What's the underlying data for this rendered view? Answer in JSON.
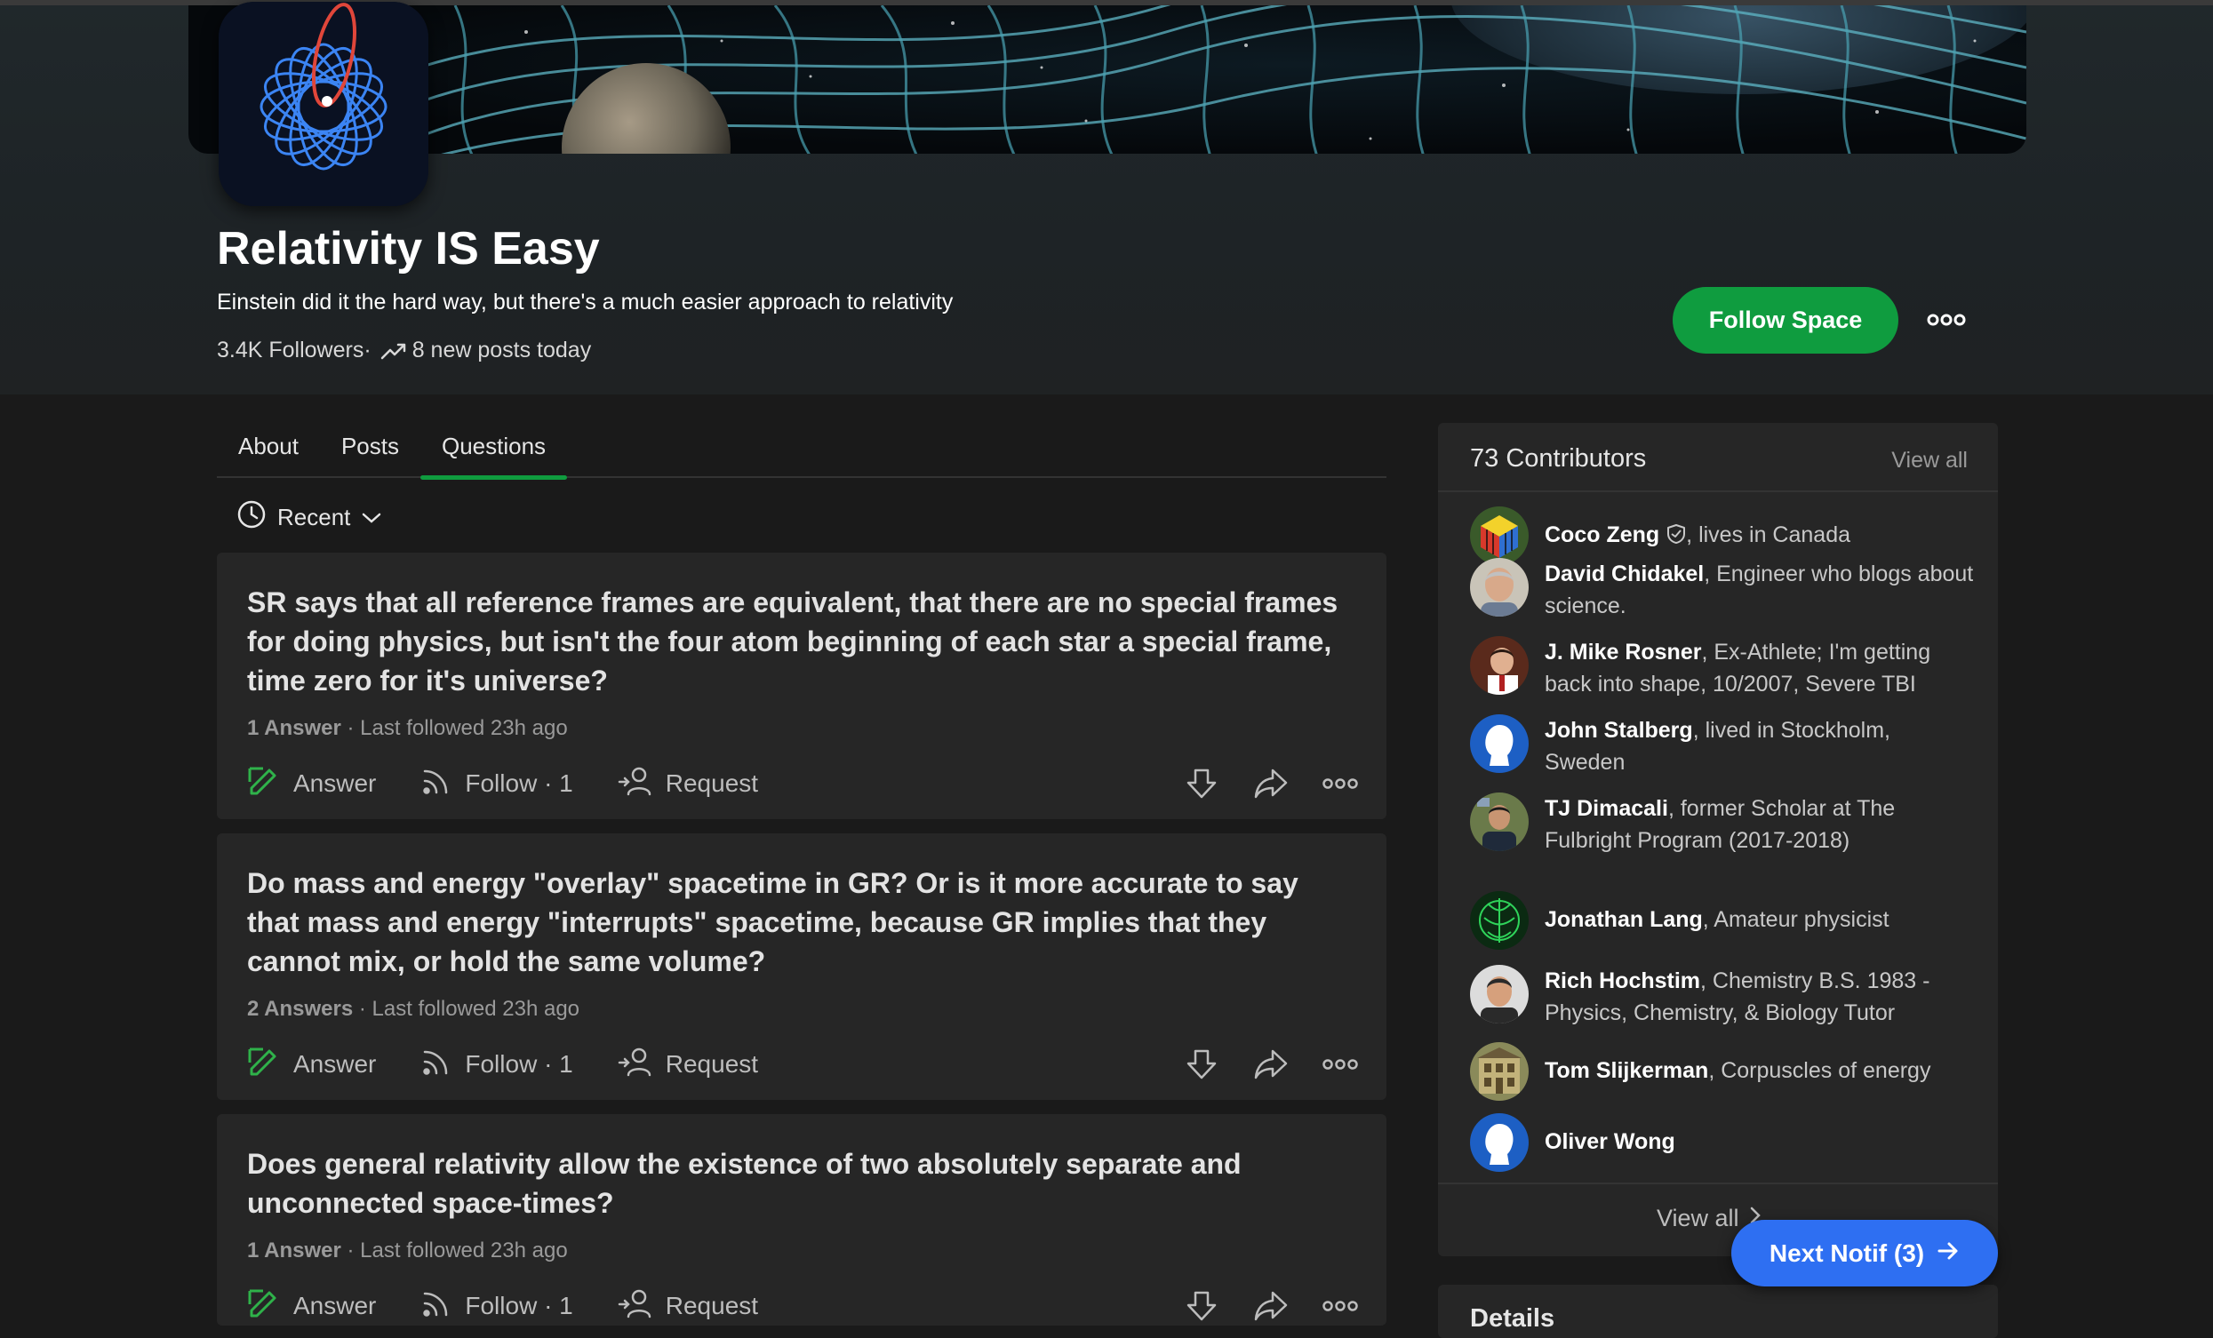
{
  "space": {
    "title": "Relativity IS Easy",
    "description": "Einstein did it the hard way, but there's a much easier approach to relativity",
    "followers": "3.4K Followers",
    "separator": " · ",
    "new_posts": "8 new posts today",
    "follow_label": "Follow Space"
  },
  "tabs": [
    {
      "label": "About"
    },
    {
      "label": "Posts"
    },
    {
      "label": "Questions",
      "active": true
    }
  ],
  "sort": {
    "label": "Recent"
  },
  "questions": [
    {
      "text": "SR says that all reference frames are equivalent, that there are no special frames for doing physics, but isn't the four atom beginning of each star a special frame, time zero for it's universe?",
      "answers": "1 Answer",
      "followed": " · Last followed 23h ago",
      "answer_label": "Answer",
      "follow_label": "Follow",
      "follow_count": " · 1",
      "request_label": "Request"
    },
    {
      "text": "Do mass and energy \"overlay\" spacetime in GR? Or is it more accurate to say that mass and energy \"interrupts\" spacetime, because GR implies that they cannot mix, or hold the same volume?",
      "answers": "2 Answers",
      "followed": " · Last followed 23h ago",
      "answer_label": "Answer",
      "follow_label": "Follow",
      "follow_count": " · 1",
      "request_label": "Request"
    },
    {
      "text": "Does general relativity allow the existence of two absolutely separate and unconnected space-times?",
      "answers": "1 Answer",
      "followed": " · Last followed 23h ago",
      "answer_label": "Answer",
      "follow_label": "Follow",
      "follow_count": " · 1",
      "request_label": "Request"
    }
  ],
  "contributors": {
    "title": "73 Contributors",
    "view_all": "View all",
    "people": [
      {
        "name": "Coco Zeng",
        "desc": ", lives in Canada"
      },
      {
        "name": "David Chidakel",
        "desc": ", Engineer who blogs about science."
      },
      {
        "name": "J. Mike Rosner",
        "desc": ", Ex-Athlete; I'm getting back into shape, 10/2007, Severe TBI"
      },
      {
        "name": "John Stalberg",
        "desc": ", lived in Stockholm, Sweden"
      },
      {
        "name": "TJ Dimacali",
        "desc": ", former Scholar at The Fulbright Program (2017-2018)"
      },
      {
        "name": "Jonathan Lang",
        "desc": ", Amateur physicist"
      },
      {
        "name": "Rich Hochstim",
        "desc": ", Chemistry B.S. 1983 - Physics, Chemistry, & Biology Tutor"
      },
      {
        "name": "Tom Slijkerman",
        "desc": ", Corpuscles of energy"
      },
      {
        "name": "Oliver Wong",
        "desc": ""
      }
    ],
    "view_all_bottom": "View all"
  },
  "details": {
    "title": "Details"
  },
  "next_notif": {
    "label": "Next Notif (3)"
  },
  "colors": {
    "accent_green": "#0f9c3f",
    "accent_blue": "#2e6ff2",
    "card_bg": "#262626",
    "page_bg": "#1a1a1a"
  }
}
